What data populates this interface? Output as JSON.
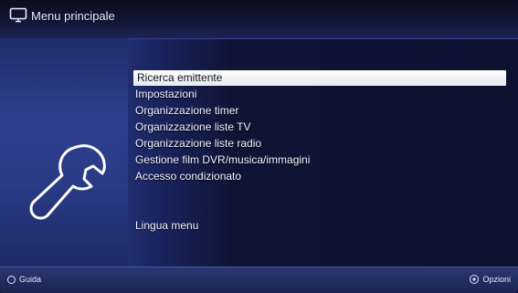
{
  "header": {
    "title": "Menu principale",
    "icon": "tv-icon"
  },
  "sidebar": {
    "icon": "wrench-icon"
  },
  "menu": {
    "items": [
      {
        "label": "Ricerca emittente",
        "selected": true
      },
      {
        "label": "Impostazioni",
        "selected": false
      },
      {
        "label": "Organizzazione timer",
        "selected": false
      },
      {
        "label": "Organizzazione liste TV",
        "selected": false
      },
      {
        "label": "Organizzazione liste radio",
        "selected": false
      },
      {
        "label": "Gestione film DVR/musica/immagini",
        "selected": false
      },
      {
        "label": "Accesso condizionato",
        "selected": false
      },
      {
        "label": "Lingua menu",
        "selected": false
      }
    ]
  },
  "footer": {
    "left_label": "Guida",
    "left_icon": "help-button-icon",
    "right_label": "Opzioni",
    "right_icon": "options-button-icon"
  },
  "colors": {
    "selection": "#ffffff",
    "background": "#0c1230",
    "panel": "#2a3a86"
  }
}
